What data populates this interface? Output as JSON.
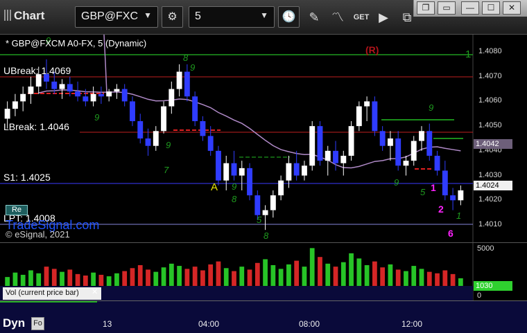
{
  "toolbar": {
    "title": "Chart",
    "symbol": "GBP@FXC",
    "interval": "5"
  },
  "chart": {
    "header": "* GBP@FXCM A0-FX, 5 (Dynamic)",
    "copyright": "© eSignal, 2021",
    "watermark": "TradeSignal.com",
    "r_marker": "(R)",
    "levels": {
      "ubreak": "UBreak: 1.4069",
      "lbreak": "LBreak: 1.4046",
      "s1": "S1: 1.4025",
      "lpt": "LPT: 1.4008",
      "r_marker_right": "1"
    },
    "pattern_label": "A",
    "price_ticks": [
      "1.4080",
      "1.4070",
      "1.4060",
      "1.4050",
      "1.4040",
      "1.4030",
      "1.4020",
      "1.4010"
    ],
    "current_price_tag": "1.4024",
    "ma_price_tag": "1.4042",
    "vol_ticks": [
      "5000",
      "0"
    ],
    "vol_tag": "1030",
    "vol_label": "Vol (current price bar)",
    "time_labels": [
      "13",
      "04:00",
      "08:00",
      "12:00"
    ],
    "bottom_label": "Dyn",
    "colors": {
      "up_bar": "#ffffff",
      "down_bar": "#2f3cff",
      "ma": "#b08ac8",
      "resistance": "#d22222",
      "support": "#22bb22",
      "s1": "#3a3aff",
      "count": "#1f9b1f",
      "magenta": "#ff22ff"
    }
  },
  "chart_data": {
    "type": "candlestick",
    "ylim": [
      1.4003,
      1.4087
    ],
    "candles": [
      [
        1.4053,
        1.406,
        1.4049,
        1.4057
      ],
      [
        1.4057,
        1.4063,
        1.4054,
        1.406
      ],
      [
        1.406,
        1.4066,
        1.4056,
        1.4063
      ],
      [
        1.4063,
        1.407,
        1.4059,
        1.4066
      ],
      [
        1.4066,
        1.4074,
        1.4063,
        1.4071
      ],
      [
        1.4071,
        1.4077,
        1.4065,
        1.4068
      ],
      [
        1.4068,
        1.4072,
        1.4063,
        1.4065
      ],
      [
        1.4065,
        1.4069,
        1.4061,
        1.4067
      ],
      [
        1.4067,
        1.407,
        1.4062,
        1.4064
      ],
      [
        1.4064,
        1.4068,
        1.406,
        1.4062
      ],
      [
        1.4062,
        1.4065,
        1.4058,
        1.406
      ],
      [
        1.406,
        1.4066,
        1.4058,
        1.4063
      ],
      [
        1.4063,
        1.4066,
        1.4059,
        1.4062
      ],
      [
        1.4062,
        1.4065,
        1.406,
        1.4064
      ],
      [
        1.4064,
        1.4067,
        1.4061,
        1.4065
      ],
      [
        1.4065,
        1.4067,
        1.4058,
        1.406
      ],
      [
        1.406,
        1.4062,
        1.405,
        1.4052
      ],
      [
        1.4052,
        1.4055,
        1.4043,
        1.4045
      ],
      [
        1.4045,
        1.4049,
        1.4038,
        1.4042
      ],
      [
        1.4042,
        1.405,
        1.404,
        1.4048
      ],
      [
        1.4048,
        1.406,
        1.4047,
        1.4058
      ],
      [
        1.4058,
        1.4068,
        1.4055,
        1.4065
      ],
      [
        1.4065,
        1.4075,
        1.4062,
        1.4072
      ],
      [
        1.4072,
        1.4075,
        1.406,
        1.4062
      ],
      [
        1.4062,
        1.4064,
        1.405,
        1.4052
      ],
      [
        1.4052,
        1.4054,
        1.4044,
        1.4046
      ],
      [
        1.4046,
        1.405,
        1.4038,
        1.404
      ],
      [
        1.404,
        1.4042,
        1.4026,
        1.4028
      ],
      [
        1.4028,
        1.4038,
        1.4024,
        1.4035
      ],
      [
        1.4035,
        1.404,
        1.4028,
        1.403
      ],
      [
        1.403,
        1.4036,
        1.4024,
        1.4033
      ],
      [
        1.4033,
        1.4035,
        1.402,
        1.4022
      ],
      [
        1.4022,
        1.4024,
        1.4012,
        1.4014
      ],
      [
        1.4014,
        1.4018,
        1.4008,
        1.4016
      ],
      [
        1.4016,
        1.4024,
        1.4013,
        1.4022
      ],
      [
        1.4022,
        1.403,
        1.402,
        1.4028
      ],
      [
        1.4028,
        1.4038,
        1.4025,
        1.4035
      ],
      [
        1.4035,
        1.404,
        1.4028,
        1.403
      ],
      [
        1.403,
        1.4036,
        1.4028,
        1.4034
      ],
      [
        1.4034,
        1.4052,
        1.4032,
        1.405
      ],
      [
        1.405,
        1.4052,
        1.4034,
        1.4036
      ],
      [
        1.4036,
        1.4042,
        1.403,
        1.404
      ],
      [
        1.404,
        1.4044,
        1.4032,
        1.4035
      ],
      [
        1.4035,
        1.404,
        1.403,
        1.4038
      ],
      [
        1.4038,
        1.4052,
        1.4036,
        1.405
      ],
      [
        1.405,
        1.406,
        1.4048,
        1.4058
      ],
      [
        1.4058,
        1.4062,
        1.4052,
        1.406
      ],
      [
        1.406,
        1.4062,
        1.4046,
        1.4048
      ],
      [
        1.4048,
        1.405,
        1.404,
        1.4042
      ],
      [
        1.4042,
        1.4048,
        1.4036,
        1.4045
      ],
      [
        1.4045,
        1.4048,
        1.4032,
        1.4034
      ],
      [
        1.4034,
        1.4038,
        1.403,
        1.4036
      ],
      [
        1.4036,
        1.4046,
        1.4034,
        1.4044
      ],
      [
        1.4044,
        1.405,
        1.404,
        1.4048
      ],
      [
        1.4048,
        1.4051,
        1.4036,
        1.4038
      ],
      [
        1.4038,
        1.404,
        1.403,
        1.4032
      ],
      [
        1.4032,
        1.4036,
        1.402,
        1.4022
      ],
      [
        1.4022,
        1.4025,
        1.4016,
        1.402
      ],
      [
        1.402,
        1.4026,
        1.4018,
        1.4024
      ]
    ],
    "volume": [
      1200,
      1800,
      1500,
      2100,
      1700,
      2600,
      2300,
      1900,
      2200,
      1600,
      1400,
      1800,
      1500,
      1300,
      1700,
      2000,
      2400,
      2800,
      2200,
      1900,
      2500,
      3000,
      2700,
      2300,
      2600,
      2100,
      2900,
      3300,
      2400,
      2000,
      2600,
      2200,
      3100,
      3600,
      2800,
      2300,
      2900,
      3400,
      2600,
      5100,
      3900,
      3000,
      2600,
      3200,
      4400,
      3700,
      2800,
      3300,
      2500,
      2900,
      2200,
      2000,
      2700,
      2300,
      1900,
      1700,
      2100,
      1600,
      1030
    ],
    "vol_ylim": [
      0,
      5600
    ]
  }
}
